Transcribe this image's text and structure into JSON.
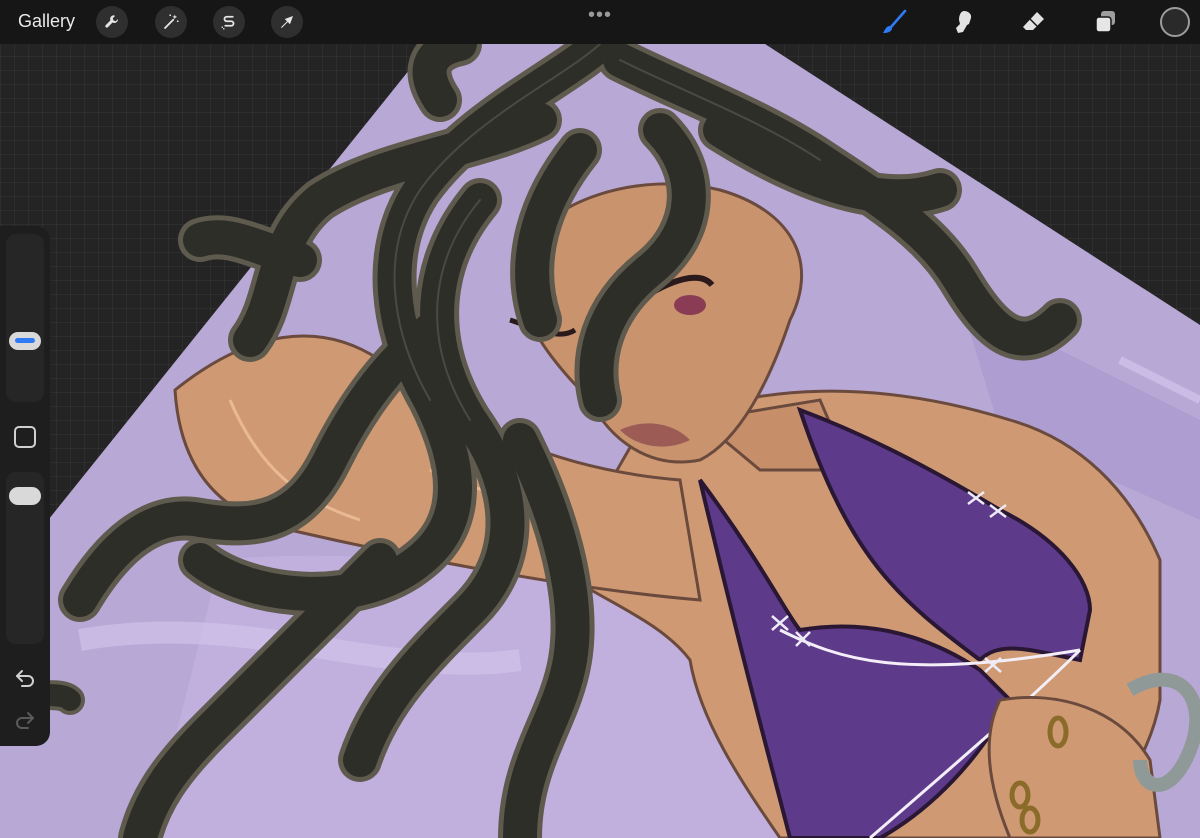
{
  "app": {
    "gallery_label": "Gallery",
    "more_label": "•••"
  },
  "left_tools": [
    {
      "name": "actions-button",
      "icon": "wrench-icon"
    },
    {
      "name": "adjustments-button",
      "icon": "magic-wand-icon"
    },
    {
      "name": "selection-button",
      "icon": "selection-s-icon"
    },
    {
      "name": "transform-button",
      "icon": "arrow-cursor-icon"
    }
  ],
  "right_tools": [
    {
      "name": "brush-tool",
      "icon": "brush-icon",
      "active": true
    },
    {
      "name": "smudge-tool",
      "icon": "smudge-icon",
      "active": false
    },
    {
      "name": "eraser-tool",
      "icon": "eraser-icon",
      "active": false
    },
    {
      "name": "layers-button",
      "icon": "layers-icon",
      "active": false
    }
  ],
  "colors": {
    "accent": "#2f7bf6",
    "current_color": "#2a2a2a",
    "canvas_background": "#b9a9d6"
  },
  "sidebar": {
    "brush_size_level": 0.35,
    "opacity_level": 0.9,
    "undo_icon": "undo-icon",
    "redo_icon": "redo-icon"
  }
}
